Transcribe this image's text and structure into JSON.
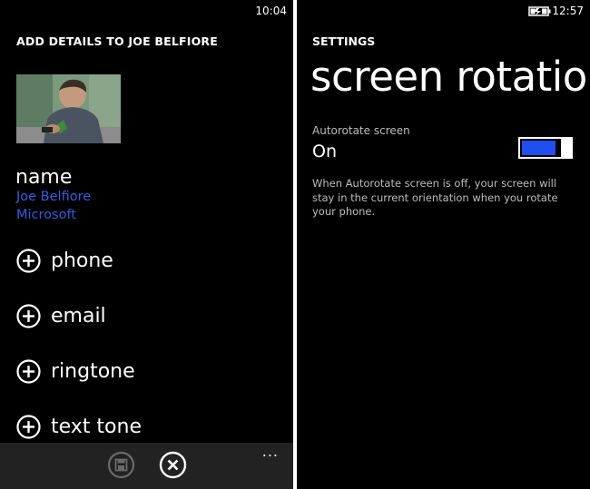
{
  "left_screen": {
    "status": {
      "time": "10:04"
    },
    "header": "ADD DETAILS TO JOE BELFIORE",
    "photo": {
      "alt": "contact photo"
    },
    "name_section": {
      "label": "name",
      "lines": [
        "Joe Belfiore",
        "Microsoft"
      ]
    },
    "add_fields": [
      {
        "label": "phone",
        "icon": "plus-circle-icon"
      },
      {
        "label": "email",
        "icon": "plus-circle-icon"
      },
      {
        "label": "ringtone",
        "icon": "plus-circle-icon"
      },
      {
        "label": "text tone",
        "icon": "plus-circle-icon"
      }
    ],
    "app_bar": {
      "buttons": [
        {
          "name": "save",
          "icon": "save-icon",
          "enabled": false
        },
        {
          "name": "cancel",
          "icon": "close-icon",
          "enabled": true
        }
      ],
      "more": "..."
    }
  },
  "right_screen": {
    "status": {
      "time": "12:57",
      "icon": "battery-charging-icon"
    },
    "header": "SETTINGS",
    "title": "screen rotation",
    "setting": {
      "label": "Autorotate screen",
      "state": "On",
      "enabled": true,
      "fill_fraction": 0.78
    },
    "description": "When Autorotate screen is off, your screen will stay in the current orientation when you rotate your phone."
  },
  "colors": {
    "accent": "#1f4ff0",
    "link": "#2f5fe6",
    "background": "#000000",
    "app_bar": "#222222"
  }
}
